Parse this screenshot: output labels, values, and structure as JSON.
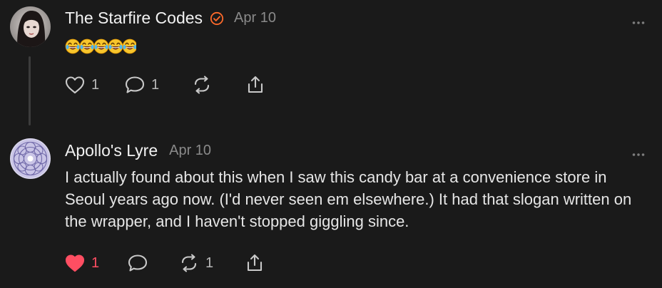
{
  "posts": [
    {
      "author": "The Starfire Codes",
      "date": "Apr 10",
      "emoji_text": "🤣🤣🤣🤣🤣",
      "likes": "1",
      "replies": "1",
      "reposts": "",
      "liked": false,
      "verified": true
    },
    {
      "author": "Apollo's Lyre",
      "date": "Apr 10",
      "text": "I actually found about this when I saw this candy bar at a convenience store in Seoul years ago now. (I'd never seen em elsewhere.) It had that slogan written on the wrapper, and I haven't stopped giggling since.",
      "likes": "1",
      "replies": "",
      "reposts": "1",
      "liked": true,
      "verified": false
    }
  ],
  "colors": {
    "background": "#1a1a1a",
    "verified_badge": "#ff6a2b",
    "like_red": "#ff4e62",
    "muted": "#8a8a8a"
  },
  "icons": [
    "verified-badge-icon",
    "more-options-icon",
    "heart-icon",
    "comment-icon",
    "repost-icon",
    "share-icon",
    "emoji-rolling-laughing-icon"
  ]
}
